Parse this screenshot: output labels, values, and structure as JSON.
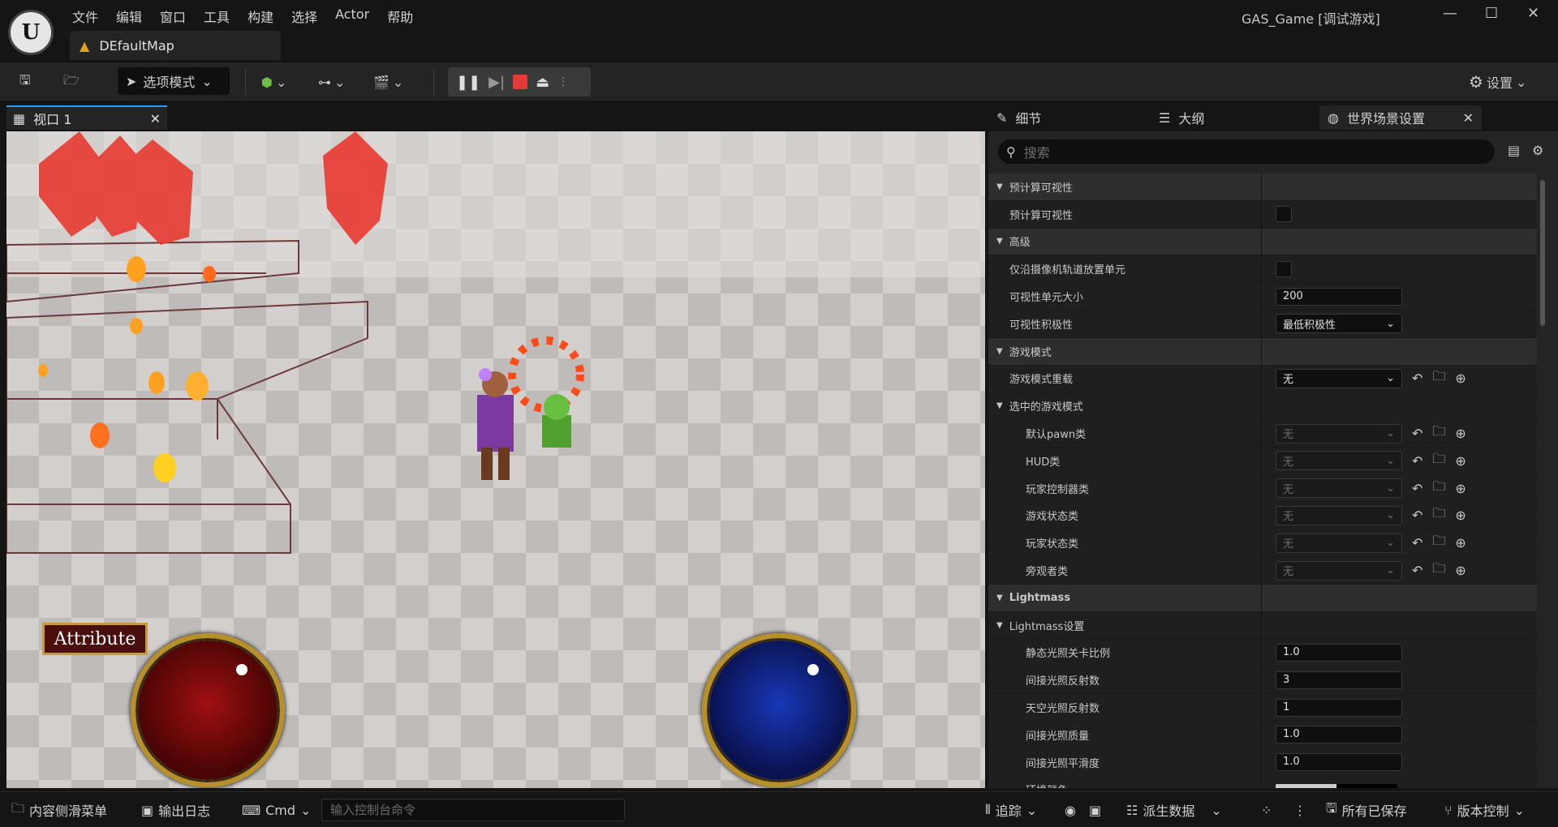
{
  "menu": [
    "文件",
    "编辑",
    "窗口",
    "工具",
    "构建",
    "选择",
    "Actor",
    "帮助"
  ],
  "doc_tab": "DEfaultMap",
  "window_title": "GAS_Game [调试游戏]",
  "logo_text": "U",
  "toolbar": {
    "mode_label": "选项模式",
    "settings_label": "设置"
  },
  "viewport": {
    "tab_label": "视口 1",
    "attribute_button": "Attribute"
  },
  "right_tabs": {
    "details": "细节",
    "outliner": "大纲",
    "world_settings": "世界场景设置"
  },
  "search": {
    "placeholder": "搜索"
  },
  "rows": [
    {
      "type": "section",
      "label": "预计算可视性",
      "indent": 0
    },
    {
      "type": "prop",
      "label": "预计算可视性",
      "indent": 1,
      "control": "checkbox"
    },
    {
      "type": "section",
      "label": "高级",
      "indent": 0
    },
    {
      "type": "prop",
      "label": "仅沿摄像机轨道放置单元",
      "indent": 1,
      "control": "checkbox"
    },
    {
      "type": "prop",
      "label": "可视性单元大小",
      "indent": 1,
      "control": "input",
      "value": "200"
    },
    {
      "type": "prop",
      "label": "可视性积极性",
      "indent": 1,
      "control": "combo",
      "value": "最低积极性"
    },
    {
      "type": "section",
      "label": "游戏模式",
      "indent": 0
    },
    {
      "type": "prop",
      "label": "游戏模式重载",
      "indent": 1,
      "control": "combo",
      "value": "无",
      "actions": true
    },
    {
      "type": "sub",
      "label": "选中的游戏模式",
      "indent": 1
    },
    {
      "type": "prop",
      "label": "默认pawn类",
      "indent": 2,
      "control": "combo-dim",
      "value": "无",
      "actions": true
    },
    {
      "type": "prop",
      "label": "HUD类",
      "indent": 2,
      "control": "combo-dim",
      "value": "无",
      "actions": true
    },
    {
      "type": "prop",
      "label": "玩家控制器类",
      "indent": 2,
      "control": "combo-dim",
      "value": "无",
      "actions": true
    },
    {
      "type": "prop",
      "label": "游戏状态类",
      "indent": 2,
      "control": "combo-dim",
      "value": "无",
      "actions": true
    },
    {
      "type": "prop",
      "label": "玩家状态类",
      "indent": 2,
      "control": "combo-dim",
      "value": "无",
      "actions": true
    },
    {
      "type": "prop",
      "label": "旁观者类",
      "indent": 2,
      "control": "combo-dim",
      "value": "无",
      "actions": true
    },
    {
      "type": "section",
      "label": "Lightmass",
      "indent": 0,
      "bold": true
    },
    {
      "type": "sub",
      "label": "Lightmass设置",
      "indent": 1
    },
    {
      "type": "prop",
      "label": "静态光照关卡比例",
      "indent": 2,
      "control": "input",
      "value": "1.0"
    },
    {
      "type": "prop",
      "label": "间接光照反射数",
      "indent": 2,
      "control": "input",
      "value": "3"
    },
    {
      "type": "prop",
      "label": "天空光照反射数",
      "indent": 2,
      "control": "input",
      "value": "1"
    },
    {
      "type": "prop",
      "label": "间接光照质量",
      "indent": 2,
      "control": "input",
      "value": "1.0"
    },
    {
      "type": "prop",
      "label": "间接光照平滑度",
      "indent": 2,
      "control": "input",
      "value": "1.0"
    },
    {
      "type": "prop",
      "label": "环境颜色",
      "indent": 2,
      "control": "color"
    }
  ],
  "statusbar": {
    "content_drawer": "内容侧滑菜单",
    "output_log": "输出日志",
    "cmd": "Cmd",
    "cmd_placeholder": "输入控制台命令",
    "trace": "追踪",
    "derived_data": "派生数据",
    "all_saved": "所有已保存",
    "source_control": "版本控制"
  },
  "colors": {
    "accent": "#2f9bf0",
    "stop": "#e53a3a",
    "health": "#8a0a0a",
    "mana": "#0a2a9a"
  }
}
